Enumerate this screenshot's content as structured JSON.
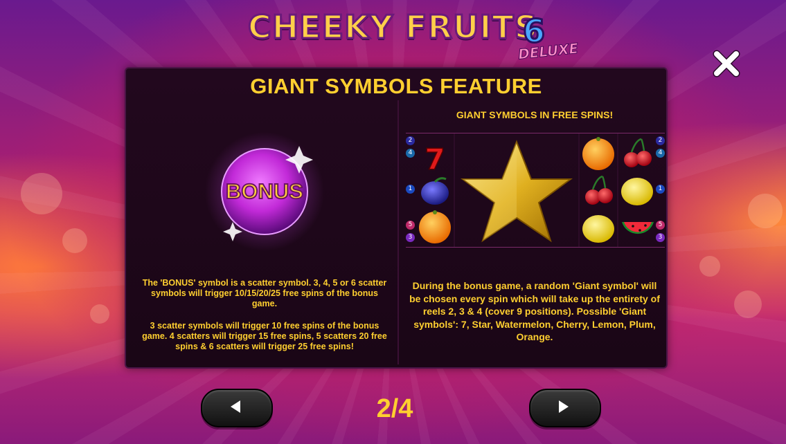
{
  "header": {
    "title_main": "CHEEKY FRUITS",
    "title_number": "6",
    "title_sub": "DELUXE"
  },
  "panel": {
    "title": "GIANT SYMBOLS FEATURE",
    "left": {
      "bonus_symbol_label": "BONUS",
      "paragraph1": "The 'BONUS' symbol is a scatter symbol. 3, 4, 5 or 6 scatter symbols will trigger 10/15/20/25 free spins of the bonus game.",
      "paragraph2": "3 scatter symbols will trigger 10 free spins of the bonus game. 4 scatters will trigger 15 free spins, 5 scatters 20 free spins & 6 scatters will trigger 25 free spins!"
    },
    "right": {
      "title": "GIANT SYMBOLS IN FREE SPINS!",
      "description": "During the bonus game, a random 'Giant symbol' will be chosen every spin which will take up the entirety of reels 2, 3 & 4 (cover 9 positions). Possible 'Giant symbols': 7, Star, Watermelon, Cherry, Lemon, Plum, Orange.",
      "line_badges_left": [
        "2",
        "4",
        "1",
        "5",
        "3"
      ],
      "line_badges_right": [
        "2",
        "4",
        "1",
        "5",
        "3"
      ]
    }
  },
  "navigation": {
    "page_indicator": "2/4"
  },
  "colors": {
    "accent_yellow": "#ffcf30",
    "panel_bg": "#1c0618",
    "bonus_purple": "#c23cd8"
  }
}
